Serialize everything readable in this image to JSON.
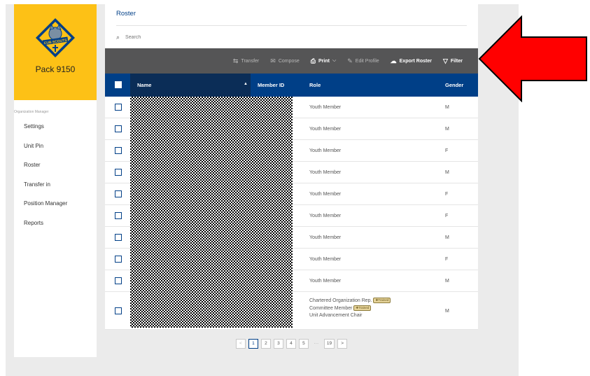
{
  "sidebar": {
    "unit_name": "Pack 9150",
    "logo_text": "CUB SCOUTS",
    "org_label": "Organization Manager",
    "items": [
      {
        "label": "Settings"
      },
      {
        "label": "Unit Pin"
      },
      {
        "label": "Roster"
      },
      {
        "label": "Transfer in"
      },
      {
        "label": "Position Manager"
      },
      {
        "label": "Reports"
      }
    ]
  },
  "main": {
    "title": "Roster",
    "search_placeholder": "Search"
  },
  "toolbar": {
    "transfer": "Transfer",
    "compose": "Compose",
    "print": "Print",
    "edit_profile": "Edit Profile",
    "export_roster": "Export Roster",
    "filter": "Filter"
  },
  "table": {
    "headers": {
      "name": "Name",
      "member_id": "Member ID",
      "role": "Role",
      "gender": "Gender"
    },
    "rows": [
      {
        "role": "Youth Member",
        "gender": "M"
      },
      {
        "role": "Youth Member",
        "gender": "M"
      },
      {
        "role": "Youth Member",
        "gender": "F"
      },
      {
        "role": "Youth Member",
        "gender": "M"
      },
      {
        "role": "Youth Member",
        "gender": "F"
      },
      {
        "role": "Youth Member",
        "gender": "F"
      },
      {
        "role": "Youth Member",
        "gender": "M"
      },
      {
        "role": "Youth Member",
        "gender": "F"
      },
      {
        "role": "Youth Member",
        "gender": "M"
      }
    ],
    "last_row": {
      "role_1": "Chartered Organization Rep.",
      "role_2": "Committee Member",
      "role_3": "Unit Advancement Chair",
      "badge": "Trained",
      "gender": "M"
    }
  },
  "pagination": {
    "prev": "<",
    "pages": [
      "1",
      "2",
      "3",
      "4",
      "5"
    ],
    "ellipsis": "···",
    "last": "19",
    "next": ">",
    "current": "1"
  },
  "colors": {
    "brand_blue": "#003f87",
    "logo_yellow": "#fdc116",
    "annotation_arrow": "#ff0000"
  }
}
